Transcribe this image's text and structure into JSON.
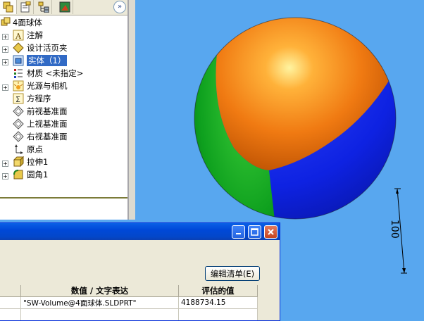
{
  "toolbar": {
    "buttons": [
      "feature-manager-icon",
      "property-manager-icon",
      "configuration-manager-icon",
      "display-manager-icon"
    ],
    "expand_glyph": "»"
  },
  "tree": {
    "root": "4面球体",
    "items": [
      {
        "label": "注解",
        "icon": "annotation-icon",
        "expandable": true
      },
      {
        "label": "设计活页夹",
        "icon": "design-binder-icon",
        "expandable": true
      },
      {
        "label": "实体（1）",
        "icon": "solid-bodies-icon",
        "expandable": true,
        "selected": true
      },
      {
        "label": "材质 <未指定>",
        "icon": "material-icon",
        "expandable": false
      },
      {
        "label": "光源与相机",
        "icon": "lights-cameras-icon",
        "expandable": true
      },
      {
        "label": "方程序",
        "icon": "equations-icon",
        "expandable": false
      },
      {
        "label": "前视基准面",
        "icon": "plane-icon",
        "expandable": false
      },
      {
        "label": "上视基准面",
        "icon": "plane-icon",
        "expandable": false
      },
      {
        "label": "右视基准面",
        "icon": "plane-icon",
        "expandable": false
      },
      {
        "label": "原点",
        "icon": "origin-icon",
        "expandable": false
      },
      {
        "label": "拉伸1",
        "icon": "extrude-icon",
        "expandable": true
      },
      {
        "label": "圆角1",
        "icon": "fillet-icon",
        "expandable": true
      }
    ]
  },
  "viewport": {
    "dimension": "100",
    "colors": {
      "orange": "#f07a12",
      "green": "#0ea01e",
      "blue": "#0e22e2",
      "background": "#58a7ef"
    }
  },
  "dialog": {
    "edit_list_label": "编辑清单(E)",
    "columns": [
      "数值 / 文字表达",
      "评估的值"
    ],
    "rows": [
      {
        "expression": "\"SW-Volume@4面球体.SLDPRT\"",
        "value": "4188734.15"
      }
    ]
  }
}
